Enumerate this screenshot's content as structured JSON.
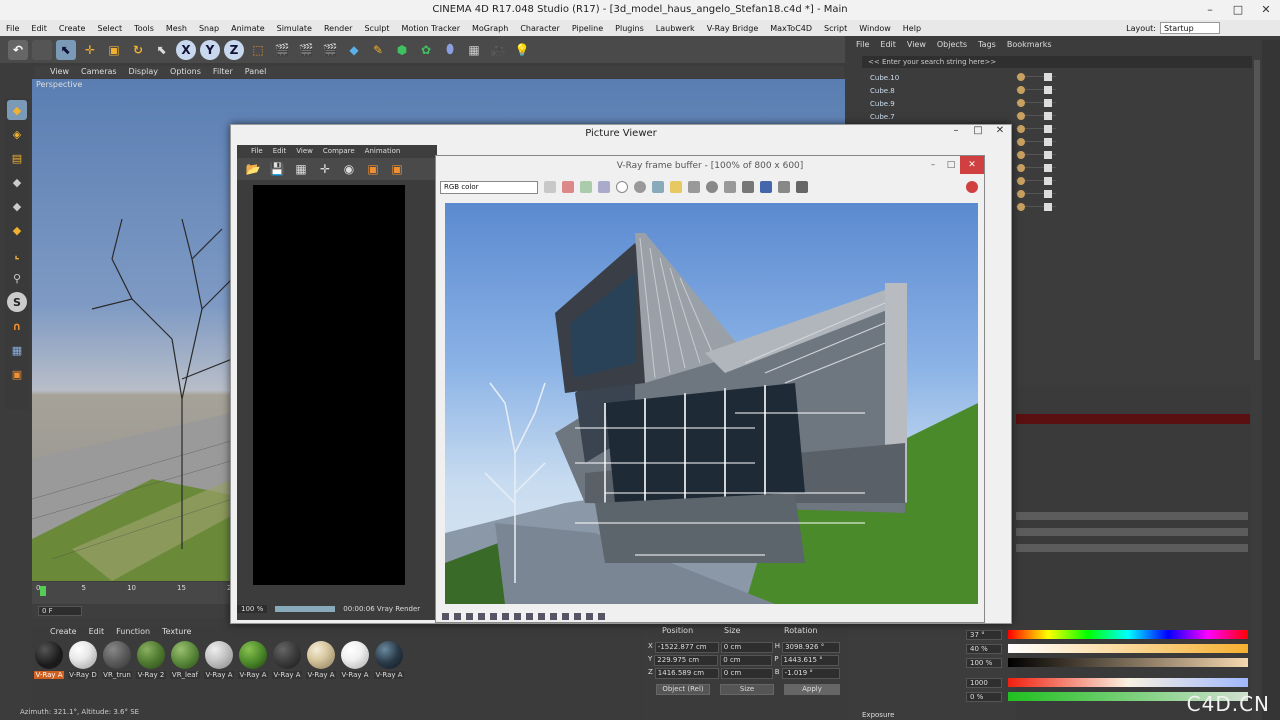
{
  "app": {
    "title": "CINEMA 4D R17.048 Studio (R17) - [3d_model_haus_angelo_Stefan18.c4d *] - Main"
  },
  "window_controls": {
    "minimize": "–",
    "maximize": "□",
    "close": "✕"
  },
  "menu": [
    "File",
    "Edit",
    "Create",
    "Select",
    "Tools",
    "Mesh",
    "Snap",
    "Animate",
    "Simulate",
    "Render",
    "Sculpt",
    "Motion Tracker",
    "MoGraph",
    "Character",
    "Pipeline",
    "Plugins",
    "Laubwerk",
    "V-Ray Bridge",
    "MaxToC4D",
    "Script",
    "Window",
    "Help"
  ],
  "layout": {
    "label": "Layout:",
    "value": "Startup"
  },
  "toolbar": {
    "x": "X",
    "y": "Y",
    "z": "Z"
  },
  "viewport": {
    "menu": [
      "View",
      "Cameras",
      "Display",
      "Options",
      "Filter",
      "Panel"
    ],
    "label": "Perspective",
    "ticks": [
      "0",
      "5",
      "10",
      "15",
      "20"
    ],
    "frame": "0 F",
    "status": "Azimuth: 321.1°, Altitude: 3.6° SE"
  },
  "materials": {
    "menu": [
      "Create",
      "Edit",
      "Function",
      "Texture"
    ],
    "items": [
      {
        "label": "V-Ray A",
        "color": "#1a1a1a"
      },
      {
        "label": "V-Ray D",
        "color": "#e8e8e8"
      },
      {
        "label": "VR_trun",
        "color": "#5a5a5a"
      },
      {
        "label": "V-Ray 2",
        "color": "#4f7a30"
      },
      {
        "label": "VR_leaf",
        "color": "#5a8a3a"
      },
      {
        "label": "V-Ray A",
        "color": "#c8c8c8"
      },
      {
        "label": "V-Ray A",
        "color": "#4c8a2a"
      },
      {
        "label": "V-Ray A",
        "color": "#3a3a3a"
      },
      {
        "label": "V-Ray A",
        "color": "#d8c8a0"
      },
      {
        "label": "V-Ray A",
        "color": "#f0f0f0"
      },
      {
        "label": "V-Ray A",
        "color": "#2a3a48"
      }
    ]
  },
  "coordinates": {
    "headers": [
      "Position",
      "Size",
      "Rotation"
    ],
    "rows": [
      {
        "axis": "X",
        "pos": "-1522.877 cm",
        "size": "0 cm",
        "rot_label": "H",
        "rot": "3098.926 °"
      },
      {
        "axis": "Y",
        "pos": "229.975 cm",
        "size": "0 cm",
        "rot_label": "P",
        "rot": "1443.615 °"
      },
      {
        "axis": "Z",
        "pos": "1416.589 cm",
        "size": "0 cm",
        "rot_label": "B",
        "rot": "-1.019 °"
      }
    ],
    "mode": "Object (Rel)",
    "size_mode": "Size",
    "apply": "Apply"
  },
  "objects": {
    "menu": [
      "File",
      "Edit",
      "View",
      "Objects",
      "Tags",
      "Bookmarks"
    ],
    "search_placeholder": "<< Enter your search string here>>",
    "items": [
      "Cube.10",
      "Cube.8",
      "Cube.9",
      "Cube.7"
    ]
  },
  "picture_viewer": {
    "title": "Picture Viewer",
    "menu": [
      "File",
      "Edit",
      "View",
      "Compare",
      "Animation"
    ],
    "zoom": "100 %",
    "status": "00:00:06 Vray Render"
  },
  "vfb": {
    "title": "V-Ray frame buffer - [100% of 800 x 600]",
    "channel": "RGB color"
  },
  "attributes": {
    "h_label": "H",
    "h_value": "37 °",
    "s_label": "S",
    "s_value": "40 %",
    "v_label": "V",
    "v_value": "100 %",
    "k_value": "1000",
    "t_label": "T",
    "t_value": "0 %",
    "exposure": "Exposure"
  },
  "watermark": "C4D.CN"
}
